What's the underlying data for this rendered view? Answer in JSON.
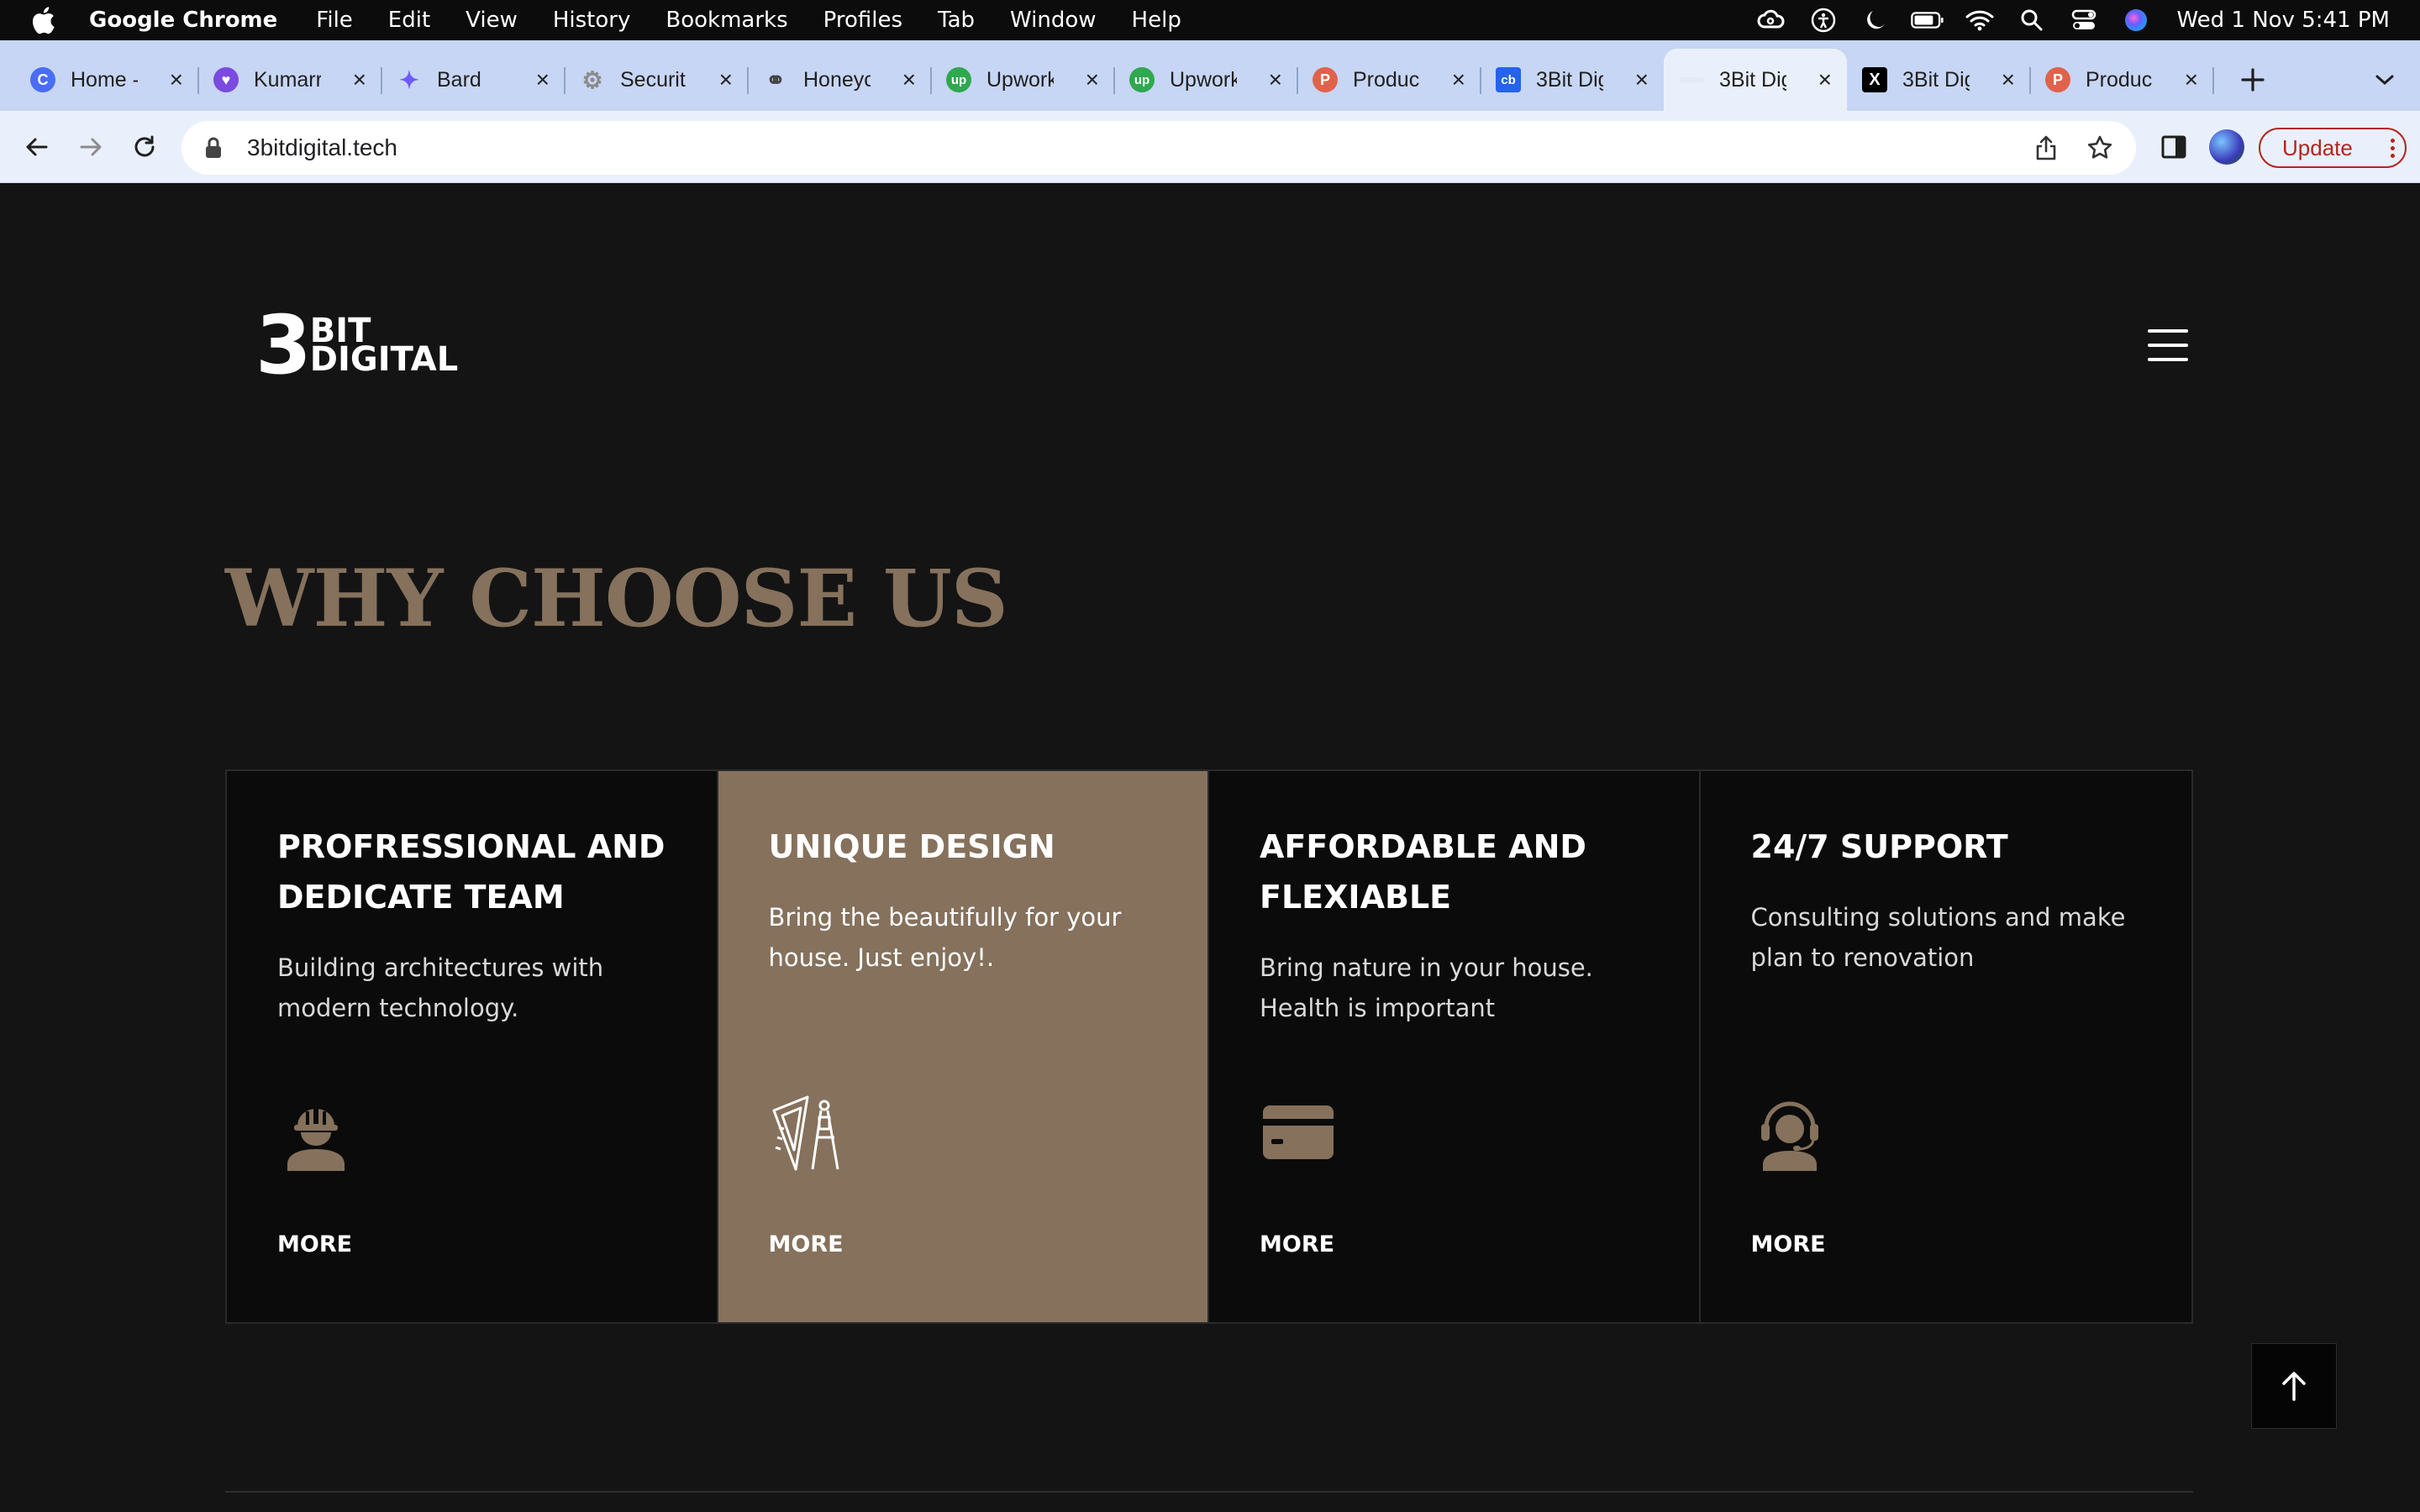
{
  "menubar": {
    "app_name": "Google Chrome",
    "items": [
      "File",
      "Edit",
      "View",
      "History",
      "Bookmarks",
      "Profiles",
      "Tab",
      "Window",
      "Help"
    ],
    "clock": "Wed 1 Nov  5:41 PM",
    "status_icons": [
      "creative-cloud-icon",
      "accessibility-icon",
      "moon-icon",
      "battery-icon",
      "wifi-icon",
      "search-icon",
      "control-center-icon",
      "siri-icon"
    ]
  },
  "tabs": [
    {
      "label": "Home -",
      "favicon": "C",
      "color": "#4a6cf7"
    },
    {
      "label": "Kumarr",
      "favicon": "♥",
      "color": "#7b4ae0"
    },
    {
      "label": "Bard",
      "favicon": "✦",
      "color": "#c7d6f4"
    },
    {
      "label": "Securit",
      "favicon": "⚙",
      "color": "#c7d6f4"
    },
    {
      "label": "Honeyc",
      "favicon": "⚭",
      "color": "#c7d6f4"
    },
    {
      "label": "Upwork",
      "favicon": "up",
      "color": "#2fa84f"
    },
    {
      "label": "Upwork",
      "favicon": "up",
      "color": "#2fa84f"
    },
    {
      "label": "Produc",
      "favicon": "P",
      "color": "#e0624b"
    },
    {
      "label": "3Bit Dig",
      "favicon": "cb",
      "color": "#2563eb"
    },
    {
      "label": "3Bit Dig",
      "favicon": "",
      "color": "#eaf0fb"
    },
    {
      "label": "3Bit Dig",
      "favicon": "X",
      "color": "#000000"
    },
    {
      "label": "Produc",
      "favicon": "P",
      "color": "#e0624b"
    }
  ],
  "active_tab_index": 9,
  "toolbar": {
    "url": "3bitdigital.tech",
    "update_label": "Update"
  },
  "site": {
    "logo_number": "3",
    "logo_line1": "BIT",
    "logo_line2": "DIGITAL",
    "section_title": "WHY CHOOSE US",
    "accent_color": "#85715c",
    "features": [
      {
        "title": "PROFRESSIONAL AND DEDICATE TEAM",
        "description": "Building architectures with modern technology.",
        "icon": "worker-helmet-icon",
        "more": "MORE"
      },
      {
        "title": "UNIQUE DESIGN",
        "description": "Bring the beautifully for your house. Just enjoy!.",
        "icon": "drafting-tools-icon",
        "more": "MORE"
      },
      {
        "title": "AFFORDABLE AND FLEXIABLE",
        "description": "Bring nature in your house. Health is important",
        "icon": "credit-card-icon",
        "more": "MORE"
      },
      {
        "title": "24/7 SUPPORT",
        "description": "Consulting solutions and make plan to renovation",
        "icon": "headset-support-icon",
        "more": "MORE"
      }
    ]
  }
}
